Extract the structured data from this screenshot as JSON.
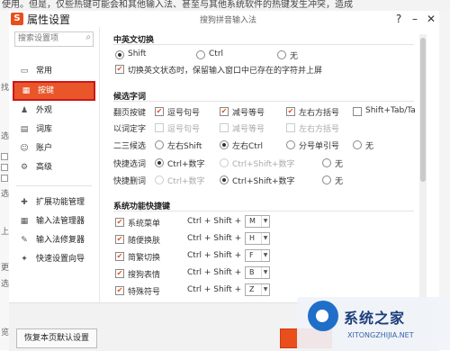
{
  "background": {
    "top_text": "使用。但是，仅些热键可能会和其他输入法、甚至与其他系统软件的热键发生冲突，造成",
    "left_edge_chars": [
      "找",
      "选",
      "选",
      "上",
      "更",
      "选"
    ],
    "left_bottom_char": "览"
  },
  "dialog": {
    "title": "属性设置",
    "window_title": "搜狗拼音输入法",
    "help_label": "?",
    "minimize_label": "–",
    "close_label": "✕",
    "logo_text": "S"
  },
  "search": {
    "placeholder": "搜索设置项"
  },
  "sidebar": {
    "items": [
      {
        "label": "常用",
        "icon": "monitor-icon"
      },
      {
        "label": "按键",
        "icon": "keyboard-icon",
        "active": true
      },
      {
        "label": "外观",
        "icon": "shirt-icon"
      },
      {
        "label": "词库",
        "icon": "book-icon"
      },
      {
        "label": "账户",
        "icon": "user-icon"
      },
      {
        "label": "高级",
        "icon": "gear-icon"
      }
    ],
    "tools": [
      {
        "label": "扩展功能管理",
        "icon": "puzzle-icon"
      },
      {
        "label": "输入法管理器",
        "icon": "grid-icon"
      },
      {
        "label": "输入法修复器",
        "icon": "repair-icon"
      },
      {
        "label": "快速设置向导",
        "icon": "wizard-icon"
      }
    ]
  },
  "switch_section": {
    "title": "中英文切换",
    "options": [
      "Shift",
      "Ctrl",
      "无"
    ],
    "selected": "Shift",
    "checkbox_label": "切换英文状态时，保留输入窗口中已存在的字符并上屏",
    "checkbox_checked": true
  },
  "candidates_section": {
    "title": "候选字词",
    "page_row": {
      "label": "翻页按键",
      "options": [
        {
          "label": "逗号句号",
          "checked": true
        },
        {
          "label": "减号等号",
          "checked": true
        },
        {
          "label": "左右方括号",
          "checked": true
        },
        {
          "label": "Shift+Tab/Tab",
          "checked": false
        }
      ]
    },
    "word_row": {
      "label": "以词定字",
      "options": [
        {
          "label": "逗号句号"
        },
        {
          "label": "减号等号"
        },
        {
          "label": "左右方括号"
        }
      ]
    },
    "second_third_row": {
      "label": "二三候选",
      "options": [
        "左右Shift",
        "左右Ctrl",
        "分号单引号",
        "无"
      ],
      "selected": "左右Ctrl"
    },
    "quick_select_row": {
      "label": "快捷选词",
      "options": [
        "Ctrl+数字",
        "Ctrl+Shift+数字",
        "无"
      ],
      "selected": "Ctrl+数字"
    },
    "quick_delete_row": {
      "label": "快捷删词",
      "options": [
        "Ctrl+数字",
        "Ctrl+Shift+数字",
        "无"
      ],
      "selected": "Ctrl+Shift+数字"
    }
  },
  "hotkeys_section": {
    "title": "系统功能快捷键",
    "prefix": "Ctrl + Shift +",
    "items": [
      {
        "label": "系统菜单",
        "key": "M",
        "checked": true
      },
      {
        "label": "随便换肤",
        "key": "H",
        "checked": true
      },
      {
        "label": "简繁切换",
        "key": "F",
        "checked": true
      },
      {
        "label": "搜狗表情",
        "key": "B",
        "checked": true
      },
      {
        "label": "特殊符号",
        "key": "Z",
        "checked": true
      }
    ]
  },
  "footer": {
    "reset_label": "恢复本页默认设置"
  },
  "watermark": {
    "text": "系统之家",
    "url": "XITONGZHIJIA.NET"
  },
  "colors": {
    "accent": "#e94e1b",
    "highlight_border": "#cc1818",
    "watermark_blue": "#1f6fc9"
  }
}
